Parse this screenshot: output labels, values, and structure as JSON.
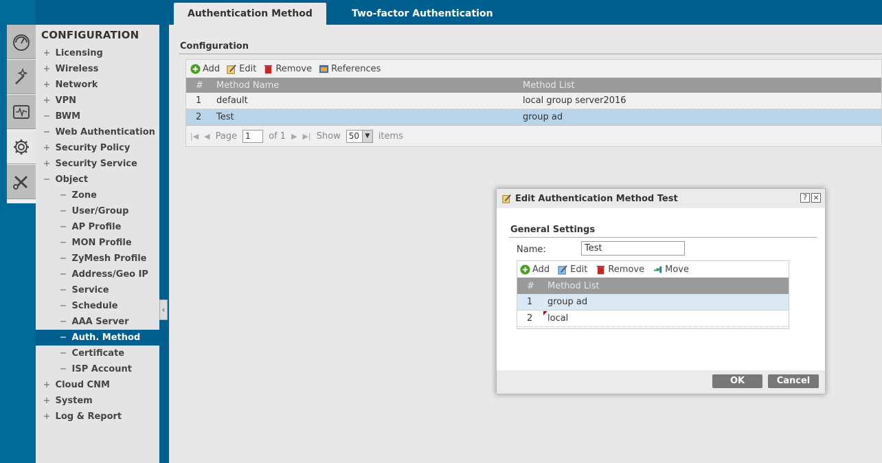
{
  "tabs": [
    {
      "label": "Authentication Method"
    },
    {
      "label": "Two-factor Authentication"
    }
  ],
  "sidebar": {
    "title": "CONFIGURATION",
    "items": [
      {
        "sym": "+",
        "label": "Licensing",
        "level": 1
      },
      {
        "sym": "+",
        "label": "Wireless",
        "level": 1
      },
      {
        "sym": "+",
        "label": "Network",
        "level": 1
      },
      {
        "sym": "+",
        "label": "VPN",
        "level": 1
      },
      {
        "sym": "−",
        "label": "BWM",
        "level": 1
      },
      {
        "sym": "−",
        "label": "Web Authentication",
        "level": 1
      },
      {
        "sym": "+",
        "label": "Security Policy",
        "level": 1
      },
      {
        "sym": "+",
        "label": "Security Service",
        "level": 1
      },
      {
        "sym": "−",
        "label": "Object",
        "level": 1
      },
      {
        "sym": "−",
        "label": "Zone",
        "level": 2
      },
      {
        "sym": "−",
        "label": "User/Group",
        "level": 2
      },
      {
        "sym": "−",
        "label": "AP Profile",
        "level": 2
      },
      {
        "sym": "−",
        "label": "MON Profile",
        "level": 2
      },
      {
        "sym": "−",
        "label": "ZyMesh Profile",
        "level": 2
      },
      {
        "sym": "−",
        "label": "Address/Geo IP",
        "level": 2
      },
      {
        "sym": "−",
        "label": "Service",
        "level": 2
      },
      {
        "sym": "−",
        "label": "Schedule",
        "level": 2
      },
      {
        "sym": "−",
        "label": "AAA Server",
        "level": 2
      },
      {
        "sym": "−",
        "label": "Auth. Method",
        "level": 2,
        "active": true
      },
      {
        "sym": "−",
        "label": "Certificate",
        "level": 2
      },
      {
        "sym": "−",
        "label": "ISP Account",
        "level": 2
      },
      {
        "sym": "+",
        "label": "Cloud CNM",
        "level": 1
      },
      {
        "sym": "+",
        "label": "System",
        "level": 1
      },
      {
        "sym": "+",
        "label": "Log & Report",
        "level": 1
      }
    ]
  },
  "rail_icons": [
    "dashboard-icon",
    "quick-setup-wand-icon",
    "monitor-icon",
    "configuration-gear-icon",
    "maintenance-tools-icon"
  ],
  "main": {
    "section_title": "Configuration",
    "toolbar": {
      "add": "Add",
      "edit": "Edit",
      "remove": "Remove",
      "references": "References"
    },
    "columns": {
      "num": "#",
      "name": "Method Name",
      "list": "Method List"
    },
    "rows": [
      {
        "num": "1",
        "name": "default",
        "list": "local group server2016"
      },
      {
        "num": "2",
        "name": "Test",
        "list": "group ad",
        "selected": true
      }
    ],
    "pager": {
      "page_label": "Page",
      "page_value": "1",
      "of_label": "of 1",
      "show_label": "Show",
      "show_value": "50",
      "items_label": "items"
    }
  },
  "dialog": {
    "title": "Edit Authentication Method Test",
    "help": "?",
    "close": "×",
    "section": "General Settings",
    "name_label": "Name:",
    "name_value": "Test",
    "toolbar": {
      "add": "Add",
      "edit": "Edit",
      "remove": "Remove",
      "move": "Move"
    },
    "columns": {
      "num": "#",
      "list": "Method List"
    },
    "rows": [
      {
        "num": "1",
        "list": "group ad"
      },
      {
        "num": "2",
        "list": "local"
      }
    ],
    "ok": "OK",
    "cancel": "Cancel"
  },
  "colors": {
    "brand_blue": "#005f8f",
    "selected_row": "#b9d4e9",
    "header_gray": "#9a9a9a",
    "add_green": "#4a9e1f",
    "remove_red": "#c62828"
  }
}
